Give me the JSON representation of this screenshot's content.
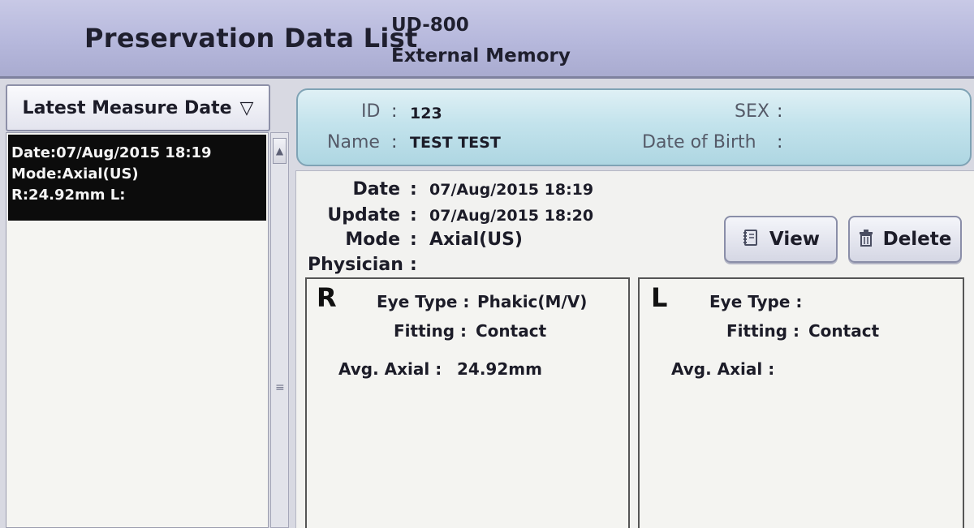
{
  "header": {
    "title": "Preservation Data List",
    "model": "UD-800",
    "memory": "External Memory"
  },
  "sort": {
    "label": "Latest Measure Date",
    "arrow": "▽"
  },
  "list": {
    "items": [
      {
        "date": "Date:07/Aug/2015 18:19",
        "mode": "Mode:Axial(US)",
        "values": "R:24.92mm L:"
      }
    ]
  },
  "scrollbar": {
    "up_icon": "▲",
    "grip_icon": "≡"
  },
  "patient": {
    "id_label": "ID",
    "id_value": "123",
    "name_label": "Name",
    "name_value": "TEST TEST",
    "sex_label": "SEX",
    "sex_value": "",
    "dob_label": "Date of Birth",
    "dob_value": "",
    "colon": ":"
  },
  "detail": {
    "date_label": "Date",
    "date_value": "07/Aug/2015 18:19",
    "update_label": "Update",
    "update_value": "07/Aug/2015 18:20",
    "mode_label": "Mode",
    "mode_value": "Axial(US)",
    "physician_label": "Physician",
    "physician_value": "",
    "colon": ":"
  },
  "buttons": {
    "view_label": "View",
    "view_icon": "book-icon",
    "delete_label": "Delete",
    "delete_icon": "trash-icon"
  },
  "eyes": {
    "right": {
      "letter": "R",
      "eye_type_label": "Eye Type :",
      "eye_type_value": "Phakic(M/V)",
      "fitting_label": "Fitting :",
      "fitting_value": "Contact",
      "axial_label": "Avg. Axial :",
      "axial_value": "24.92mm"
    },
    "left": {
      "letter": "L",
      "eye_type_label": "Eye Type :",
      "eye_type_value": "",
      "fitting_label": "Fitting :",
      "fitting_value": "Contact",
      "axial_label": "Avg. Axial :",
      "axial_value": ""
    }
  }
}
